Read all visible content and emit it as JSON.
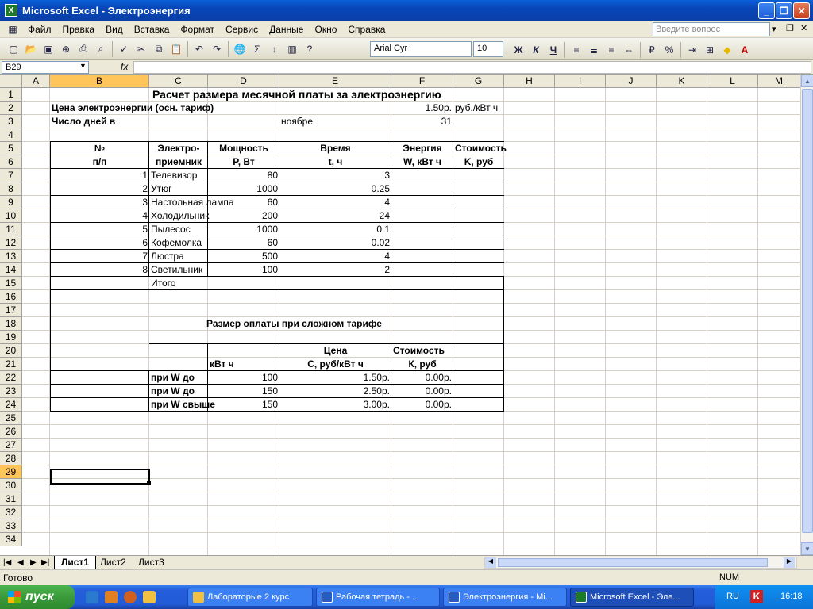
{
  "window": {
    "title": "Microsoft Excel - Электроэнергия",
    "icon": "excel-icon"
  },
  "menu": {
    "items": [
      "Файл",
      "Правка",
      "Вид",
      "Вставка",
      "Формат",
      "Сервис",
      "Данные",
      "Окно",
      "Справка"
    ],
    "ask_placeholder": "Введите вопрос"
  },
  "toolbar": {
    "font": "Arial Cyr",
    "size": "10",
    "bold": "Ж",
    "italic": "К",
    "underline": "Ч",
    "percent": "%"
  },
  "formula": {
    "namebox": "B29",
    "fx": "fx",
    "content": ""
  },
  "columns": [
    "A",
    "B",
    "C",
    "D",
    "E",
    "F",
    "G",
    "H",
    "I",
    "J",
    "K",
    "L",
    "M"
  ],
  "rows": [
    "1",
    "2",
    "3",
    "4",
    "5",
    "6",
    "7",
    "8",
    "9",
    "10",
    "11",
    "12",
    "13",
    "14",
    "15",
    "16",
    "17",
    "18",
    "19",
    "20",
    "21",
    "22",
    "23",
    "24",
    "25",
    "26",
    "27",
    "28",
    "29",
    "30",
    "31",
    "32",
    "33",
    "34"
  ],
  "sheet": {
    "title": "Расчет размера месячной платы за электроэнергию",
    "price_label": "Цена электроэнергии (осн. тариф)",
    "price_value": "1.50р.",
    "price_unit": "руб./кВт ч",
    "days_label": "Число дней в",
    "days_month": "ноябре",
    "days_value": "31",
    "headers": {
      "a5": "№",
      "a6": "п/п",
      "b5": "Электро-",
      "b6": "приемник",
      "c5": "Мощность",
      "c6": "P, Вт",
      "d5": "Время",
      "d6": "t, ч",
      "e5": "Энергия",
      "e6": "W, кВт ч",
      "f5": "Стоимость",
      "f6": "K, руб"
    },
    "items": [
      {
        "n": "1",
        "name": "Телевизор",
        "p": "80",
        "t": "3"
      },
      {
        "n": "2",
        "name": "Утюг",
        "p": "1000",
        "t": "0.25"
      },
      {
        "n": "3",
        "name": "Настольная лампа",
        "p": "60",
        "t": "4"
      },
      {
        "n": "4",
        "name": "Холодильник",
        "p": "200",
        "t": "24"
      },
      {
        "n": "5",
        "name": "Пылесос",
        "p": "1000",
        "t": "0.1"
      },
      {
        "n": "6",
        "name": "Кофемолка",
        "p": "60",
        "t": "0.02"
      },
      {
        "n": "7",
        "name": "Люстра",
        "p": "500",
        "t": "4"
      },
      {
        "n": "8",
        "name": "Светильник",
        "p": "100",
        "t": "2"
      }
    ],
    "total_label": "Итого",
    "complex_title": "Размер оплаты при сложном тарифе",
    "complex_headers": {
      "d20": "Цена",
      "e20": "Стоимость",
      "c21": "кВт ч",
      "d21": "С, руб/кВт ч",
      "e21": "К, руб"
    },
    "tariffs": [
      {
        "label": "при W до",
        "kwh": "100",
        "price": "1.50р.",
        "cost": "0.00р."
      },
      {
        "label": "при W до",
        "kwh": "150",
        "price": "2.50р.",
        "cost": "0.00р."
      },
      {
        "label": "при W свыше",
        "kwh": "150",
        "price": "3.00р.",
        "cost": "0.00р."
      }
    ]
  },
  "tabs": [
    "Лист1",
    "Лист2",
    "Лист3"
  ],
  "status": {
    "left": "Готово",
    "num": "NUM"
  },
  "taskbar": {
    "start": "пуск",
    "tasks": [
      "Лабораторые 2 курс",
      "Рабочая тетрадь - ...",
      "Электроэнергия - Mi...",
      "Microsoft Excel - Эле..."
    ],
    "lang": "RU",
    "time": "16:18"
  },
  "colors": {
    "selection": "#ffc55a",
    "titlebar": "#0a46b8",
    "start": "#3a9a3a"
  }
}
